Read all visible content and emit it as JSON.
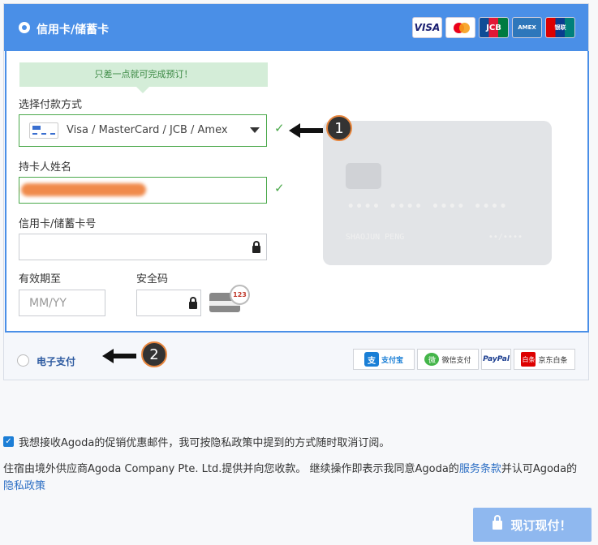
{
  "card_section": {
    "title": "信用卡/储蓄卡",
    "logos": [
      "VISA",
      "MC",
      "JCB",
      "AMEX",
      "UnionPay"
    ]
  },
  "form": {
    "tip": "只差一点就可完成预订！",
    "method_label": "选择付款方式",
    "method_value": "Visa / MasterCard / JCB / Amex",
    "holder_label": "持卡人姓名",
    "card_number_label": "信用卡/储蓄卡号",
    "expiry_label": "有效期至",
    "expiry_placeholder": "MM/YY",
    "cvv_label": "安全码",
    "cvv_icon_text": "123"
  },
  "preview": {
    "number": "•••• •••• •••• ••••",
    "holder": "SHAOJUN PENG",
    "expiry": "••/••••"
  },
  "callouts": [
    "1",
    "2"
  ],
  "epay": {
    "title": "电子支付",
    "wallets": [
      {
        "name": "支付宝",
        "sub": "ALIPAY",
        "icon": "支"
      },
      {
        "name": "微信支付",
        "icon": "微"
      },
      {
        "name": "PayPal"
      },
      {
        "name": "京东白条",
        "icon": "白条"
      }
    ]
  },
  "consent_text": "我想接收Agoda的促销优惠邮件，我可按隐私政策中提到的方式随时取消订阅。",
  "terms": {
    "part1": "住宿由境外供应商Agoda Company Pte. Ltd.提供并向您收款。 继续操作即表示我同意Agoda的",
    "link1": "服务条款",
    "part2": "并认可Agoda的",
    "link2": "隐私政策"
  },
  "book_button": "现订现付！",
  "colors": {
    "accent": "#4a8fe7",
    "valid": "#4aa84a",
    "button": "#8fb8ef"
  }
}
